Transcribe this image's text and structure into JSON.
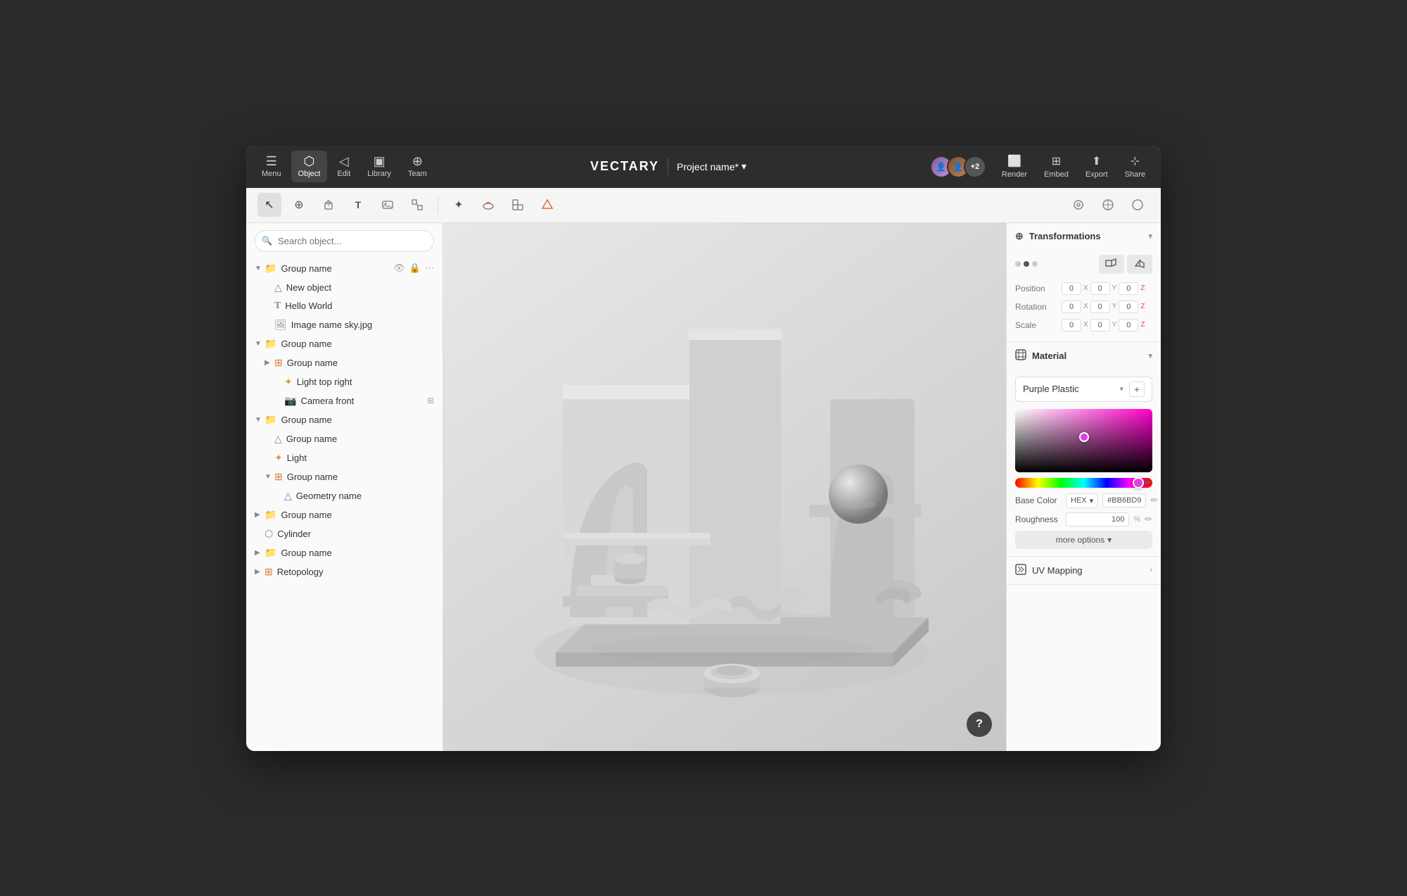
{
  "app": {
    "title": "VECTARY",
    "project_name": "Project name*"
  },
  "topbar": {
    "nav": [
      {
        "id": "menu",
        "label": "Menu",
        "icon": "☰",
        "active": false
      },
      {
        "id": "object",
        "label": "Object",
        "icon": "⬡",
        "active": true
      },
      {
        "id": "edit",
        "label": "Edit",
        "icon": "◁",
        "active": false
      },
      {
        "id": "library",
        "label": "Library",
        "icon": "▣",
        "active": false
      },
      {
        "id": "team",
        "label": "Team",
        "icon": "⊕",
        "active": false
      }
    ],
    "right_actions": [
      {
        "id": "render",
        "label": "Render",
        "icon": "⬜"
      },
      {
        "id": "embed",
        "label": "Embed",
        "icon": "⊞"
      },
      {
        "id": "export",
        "label": "Export",
        "icon": "⬆"
      },
      {
        "id": "share",
        "label": "Share",
        "icon": "⊹"
      }
    ],
    "collaborators_count": "+2"
  },
  "toolbar": {
    "tools": [
      {
        "id": "select",
        "icon": "↖",
        "active": true
      },
      {
        "id": "transform",
        "icon": "⊕",
        "active": false
      },
      {
        "id": "box",
        "icon": "⬡",
        "active": false
      },
      {
        "id": "text",
        "icon": "T",
        "active": false
      },
      {
        "id": "image",
        "icon": "⊞",
        "active": false
      },
      {
        "id": "vector",
        "icon": "⊡",
        "active": false
      },
      {
        "id": "light",
        "icon": "✦",
        "active": false
      },
      {
        "id": "sculpt",
        "icon": "◑",
        "active": false
      },
      {
        "id": "group",
        "icon": "⊕",
        "active": false
      },
      {
        "id": "boolean",
        "icon": "⬢",
        "active": false
      }
    ],
    "right_tools": [
      {
        "id": "target",
        "icon": "⊕"
      },
      {
        "id": "snap",
        "icon": "⊗"
      },
      {
        "id": "circle",
        "icon": "○"
      }
    ]
  },
  "left_panel": {
    "search_placeholder": "Search object...",
    "tree": [
      {
        "id": "g1",
        "label": "Group name",
        "type": "group",
        "level": 0,
        "expanded": true,
        "has_actions": true
      },
      {
        "id": "n1",
        "label": "New object",
        "type": "object",
        "level": 1,
        "expanded": false
      },
      {
        "id": "hw",
        "label": "Hello World",
        "type": "text",
        "level": 1,
        "expanded": false
      },
      {
        "id": "img",
        "label": "Image name sky.jpg",
        "type": "image",
        "level": 1,
        "expanded": false
      },
      {
        "id": "g2",
        "label": "Group name",
        "type": "group",
        "level": 0,
        "expanded": true
      },
      {
        "id": "g2a",
        "label": "Group name",
        "type": "group-orange",
        "level": 1,
        "expanded": true
      },
      {
        "id": "l1",
        "label": "Light top right",
        "type": "light",
        "level": 2,
        "expanded": false
      },
      {
        "id": "c1",
        "label": "Camera front",
        "type": "camera",
        "level": 2,
        "expanded": false
      },
      {
        "id": "g3",
        "label": "Group name",
        "type": "group",
        "level": 0,
        "expanded": true
      },
      {
        "id": "g3a",
        "label": "Group name",
        "type": "object",
        "level": 1,
        "expanded": false
      },
      {
        "id": "lt",
        "label": "Light",
        "type": "light",
        "level": 1,
        "expanded": false
      },
      {
        "id": "g3b",
        "label": "Group name",
        "type": "group-orange",
        "level": 1,
        "expanded": true
      },
      {
        "id": "geom",
        "label": "Geometry name",
        "type": "geometry",
        "level": 2,
        "expanded": false
      },
      {
        "id": "g4",
        "label": "Group name",
        "type": "group",
        "level": 0,
        "expanded": false
      },
      {
        "id": "cyl",
        "label": "Cylinder",
        "type": "cylinder",
        "level": 0,
        "expanded": false
      },
      {
        "id": "g5",
        "label": "Group name",
        "type": "group",
        "level": 0,
        "expanded": false
      },
      {
        "id": "ret",
        "label": "Retopology",
        "type": "retopology",
        "level": 0,
        "expanded": false
      }
    ]
  },
  "right_panel": {
    "transformations_title": "Transformations",
    "position_label": "Position",
    "rotation_label": "Rotation",
    "scale_label": "Scale",
    "coord_values": {
      "position": {
        "x": "0",
        "y": "0",
        "z": "0"
      },
      "rotation": {
        "x": "0",
        "y": "0",
        "z": "0"
      },
      "scale": {
        "x": "0",
        "y": "0",
        "z": "0"
      }
    },
    "material_title": "Material",
    "material_name": "Purple Plastic",
    "base_color_label": "Base Color",
    "color_format": "HEX",
    "color_value": "#BB6BD9",
    "roughness_label": "Roughness",
    "roughness_value": "100",
    "roughness_unit": "%",
    "more_options_label": "more options",
    "uv_title": "UV Mapping"
  },
  "help": {
    "label": "?"
  }
}
